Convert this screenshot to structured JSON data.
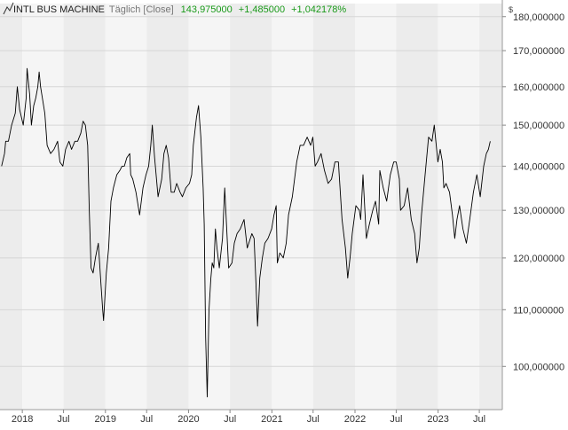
{
  "header": {
    "icon": "line-chart-icon",
    "instrument": "INTL BUS MACHINE",
    "interval": "Täglich [Close]",
    "last": "143,975000",
    "change": "+1,485000",
    "change_pct": "+1,042178%",
    "positive_color": "#1a9a1a"
  },
  "axis": {
    "currency": "$"
  },
  "colors": {
    "line": "#000000",
    "band_dark": "#ececec",
    "band_light": "#f5f5f5",
    "grid": "#d6d6d6"
  },
  "chart_data": {
    "type": "line",
    "series": [
      {
        "points": [
          [
            "2017-10-02",
            140
          ],
          [
            "2017-10-15",
            143
          ],
          [
            "2017-10-20",
            146
          ],
          [
            "2017-11-01",
            146
          ],
          [
            "2017-11-15",
            150
          ],
          [
            "2017-12-01",
            153
          ],
          [
            "2017-12-10",
            160
          ],
          [
            "2017-12-20",
            154
          ],
          [
            "2018-01-05",
            150
          ],
          [
            "2018-01-18",
            157
          ],
          [
            "2018-01-22",
            165
          ],
          [
            "2018-02-02",
            158
          ],
          [
            "2018-02-10",
            150
          ],
          [
            "2018-02-20",
            155
          ],
          [
            "2018-03-01",
            157
          ],
          [
            "2018-03-10",
            160
          ],
          [
            "2018-03-16",
            164
          ],
          [
            "2018-03-22",
            160
          ],
          [
            "2018-04-10",
            153
          ],
          [
            "2018-04-20",
            145
          ],
          [
            "2018-05-05",
            143
          ],
          [
            "2018-05-20",
            144
          ],
          [
            "2018-06-05",
            146
          ],
          [
            "2018-06-15",
            141
          ],
          [
            "2018-06-28",
            140
          ],
          [
            "2018-07-10",
            144
          ],
          [
            "2018-07-25",
            146
          ],
          [
            "2018-08-05",
            144
          ],
          [
            "2018-08-20",
            146
          ],
          [
            "2018-09-01",
            146
          ],
          [
            "2018-09-15",
            148
          ],
          [
            "2018-09-25",
            151
          ],
          [
            "2018-10-05",
            150
          ],
          [
            "2018-10-15",
            145
          ],
          [
            "2018-10-22",
            130
          ],
          [
            "2018-10-30",
            118
          ],
          [
            "2018-11-08",
            117
          ],
          [
            "2018-11-18",
            120
          ],
          [
            "2018-12-01",
            123
          ],
          [
            "2018-12-12",
            115
          ],
          [
            "2018-12-20",
            110
          ],
          [
            "2018-12-24",
            108
          ],
          [
            "2019-01-05",
            117
          ],
          [
            "2019-01-15",
            122
          ],
          [
            "2019-01-25",
            132
          ],
          [
            "2019-02-05",
            135
          ],
          [
            "2019-02-20",
            138
          ],
          [
            "2019-03-05",
            139
          ],
          [
            "2019-03-15",
            140
          ],
          [
            "2019-03-25",
            140
          ],
          [
            "2019-04-05",
            142
          ],
          [
            "2019-04-18",
            143
          ],
          [
            "2019-04-22",
            138
          ],
          [
            "2019-05-01",
            137
          ],
          [
            "2019-05-15",
            134
          ],
          [
            "2019-05-31",
            129
          ],
          [
            "2019-06-15",
            135
          ],
          [
            "2019-06-28",
            138
          ],
          [
            "2019-07-10",
            140
          ],
          [
            "2019-07-19",
            145
          ],
          [
            "2019-07-26",
            150
          ],
          [
            "2019-08-05",
            142
          ],
          [
            "2019-08-20",
            133
          ],
          [
            "2019-09-05",
            137
          ],
          [
            "2019-09-15",
            143
          ],
          [
            "2019-09-25",
            145
          ],
          [
            "2019-10-05",
            142
          ],
          [
            "2019-10-17",
            134
          ],
          [
            "2019-10-30",
            134
          ],
          [
            "2019-11-10",
            136
          ],
          [
            "2019-11-25",
            134
          ],
          [
            "2019-12-05",
            133
          ],
          [
            "2019-12-20",
            135
          ],
          [
            "2020-01-05",
            136
          ],
          [
            "2020-01-15",
            138
          ],
          [
            "2020-01-22",
            145
          ],
          [
            "2020-02-05",
            152
          ],
          [
            "2020-02-14",
            155
          ],
          [
            "2020-02-24",
            147
          ],
          [
            "2020-03-05",
            135
          ],
          [
            "2020-03-10",
            127
          ],
          [
            "2020-03-16",
            105
          ],
          [
            "2020-03-23",
            95
          ],
          [
            "2020-03-31",
            110
          ],
          [
            "2020-04-08",
            116
          ],
          [
            "2020-04-14",
            119
          ],
          [
            "2020-04-21",
            118
          ],
          [
            "2020-04-28",
            126
          ],
          [
            "2020-05-05",
            122
          ],
          [
            "2020-05-15",
            118
          ],
          [
            "2020-05-29",
            124
          ],
          [
            "2020-06-08",
            135
          ],
          [
            "2020-06-25",
            118
          ],
          [
            "2020-07-10",
            119
          ],
          [
            "2020-07-20",
            123
          ],
          [
            "2020-08-01",
            125
          ],
          [
            "2020-08-15",
            126
          ],
          [
            "2020-09-01",
            128
          ],
          [
            "2020-09-15",
            122
          ],
          [
            "2020-10-05",
            125
          ],
          [
            "2020-10-15",
            124
          ],
          [
            "2020-10-23",
            115
          ],
          [
            "2020-10-30",
            107
          ],
          [
            "2020-11-09",
            116
          ],
          [
            "2020-11-20",
            120
          ],
          [
            "2020-12-01",
            123
          ],
          [
            "2020-12-15",
            124
          ],
          [
            "2020-12-31",
            126
          ],
          [
            "2021-01-10",
            129
          ],
          [
            "2021-01-20",
            131
          ],
          [
            "2021-01-25",
            119
          ],
          [
            "2021-02-05",
            121
          ],
          [
            "2021-02-20",
            120
          ],
          [
            "2021-03-05",
            123
          ],
          [
            "2021-03-15",
            129
          ],
          [
            "2021-04-01",
            133
          ],
          [
            "2021-04-20",
            141
          ],
          [
            "2021-05-05",
            145
          ],
          [
            "2021-05-20",
            145
          ],
          [
            "2021-06-05",
            147
          ],
          [
            "2021-06-20",
            145
          ],
          [
            "2021-06-30",
            147
          ],
          [
            "2021-07-10",
            140
          ],
          [
            "2021-07-20",
            141
          ],
          [
            "2021-08-05",
            143
          ],
          [
            "2021-08-20",
            139
          ],
          [
            "2021-09-05",
            136
          ],
          [
            "2021-09-20",
            137
          ],
          [
            "2021-10-05",
            141
          ],
          [
            "2021-10-20",
            141
          ],
          [
            "2021-11-05",
            128
          ],
          [
            "2021-11-20",
            122
          ],
          [
            "2021-11-30",
            116
          ],
          [
            "2021-12-10",
            120
          ],
          [
            "2021-12-20",
            125
          ],
          [
            "2022-01-05",
            131
          ],
          [
            "2022-01-20",
            130
          ],
          [
            "2022-01-26",
            128
          ],
          [
            "2022-02-05",
            138
          ],
          [
            "2022-02-20",
            124
          ],
          [
            "2022-03-05",
            127
          ],
          [
            "2022-03-20",
            130
          ],
          [
            "2022-04-01",
            132
          ],
          [
            "2022-04-15",
            127
          ],
          [
            "2022-04-20",
            139
          ],
          [
            "2022-05-05",
            135
          ],
          [
            "2022-05-20",
            132
          ],
          [
            "2022-06-05",
            138
          ],
          [
            "2022-06-20",
            141
          ],
          [
            "2022-07-01",
            141
          ],
          [
            "2022-07-15",
            137
          ],
          [
            "2022-07-20",
            130
          ],
          [
            "2022-08-05",
            131
          ],
          [
            "2022-08-20",
            135
          ],
          [
            "2022-09-05",
            128
          ],
          [
            "2022-09-20",
            125
          ],
          [
            "2022-09-30",
            119
          ],
          [
            "2022-10-10",
            122
          ],
          [
            "2022-10-20",
            129
          ],
          [
            "2022-11-05",
            138
          ],
          [
            "2022-11-20",
            147
          ],
          [
            "2022-12-05",
            146
          ],
          [
            "2022-12-15",
            150
          ],
          [
            "2022-12-31",
            141
          ],
          [
            "2023-01-10",
            144
          ],
          [
            "2023-01-20",
            141
          ],
          [
            "2023-01-26",
            135
          ],
          [
            "2023-02-05",
            136
          ],
          [
            "2023-02-20",
            134
          ],
          [
            "2023-03-05",
            129
          ],
          [
            "2023-03-15",
            124
          ],
          [
            "2023-03-25",
            128
          ],
          [
            "2023-04-05",
            131
          ],
          [
            "2023-04-20",
            126
          ],
          [
            "2023-05-05",
            123
          ],
          [
            "2023-05-20",
            128
          ],
          [
            "2023-06-05",
            134
          ],
          [
            "2023-06-20",
            138
          ],
          [
            "2023-07-05",
            133
          ],
          [
            "2023-07-20",
            140
          ],
          [
            "2023-08-01",
            143
          ],
          [
            "2023-08-10",
            144
          ],
          [
            "2023-08-18",
            146
          ]
        ]
      }
    ],
    "xlabel": "",
    "ylabel": "",
    "x_range": [
      "2017-09-25",
      "2023-10-10"
    ],
    "y_range": [
      93,
      184
    ],
    "y_scale": "log",
    "y_ticks": [
      {
        "v": 100,
        "label": "100,000000"
      },
      {
        "v": 110,
        "label": "110,000000"
      },
      {
        "v": 120,
        "label": "120,000000"
      },
      {
        "v": 130,
        "label": "130,000000"
      },
      {
        "v": 140,
        "label": "140,000000"
      },
      {
        "v": 150,
        "label": "150,000000"
      },
      {
        "v": 160,
        "label": "160,000000"
      },
      {
        "v": 170,
        "label": "170,000000"
      },
      {
        "v": 180,
        "label": "180,000000"
      }
    ],
    "x_ticks": [
      {
        "date": "2018-01-01",
        "label": "2018"
      },
      {
        "date": "2018-07-01",
        "label": "Jul"
      },
      {
        "date": "2019-01-01",
        "label": "2019"
      },
      {
        "date": "2019-07-01",
        "label": "Jul"
      },
      {
        "date": "2020-01-01",
        "label": "2020"
      },
      {
        "date": "2020-07-01",
        "label": "Jul"
      },
      {
        "date": "2021-01-01",
        "label": "2021"
      },
      {
        "date": "2021-07-01",
        "label": "Jul"
      },
      {
        "date": "2022-01-01",
        "label": "2022"
      },
      {
        "date": "2022-07-01",
        "label": "Jul"
      },
      {
        "date": "2023-01-01",
        "label": "2023"
      },
      {
        "date": "2023-07-01",
        "label": "Jul"
      }
    ],
    "grid": true,
    "legend": "none"
  }
}
